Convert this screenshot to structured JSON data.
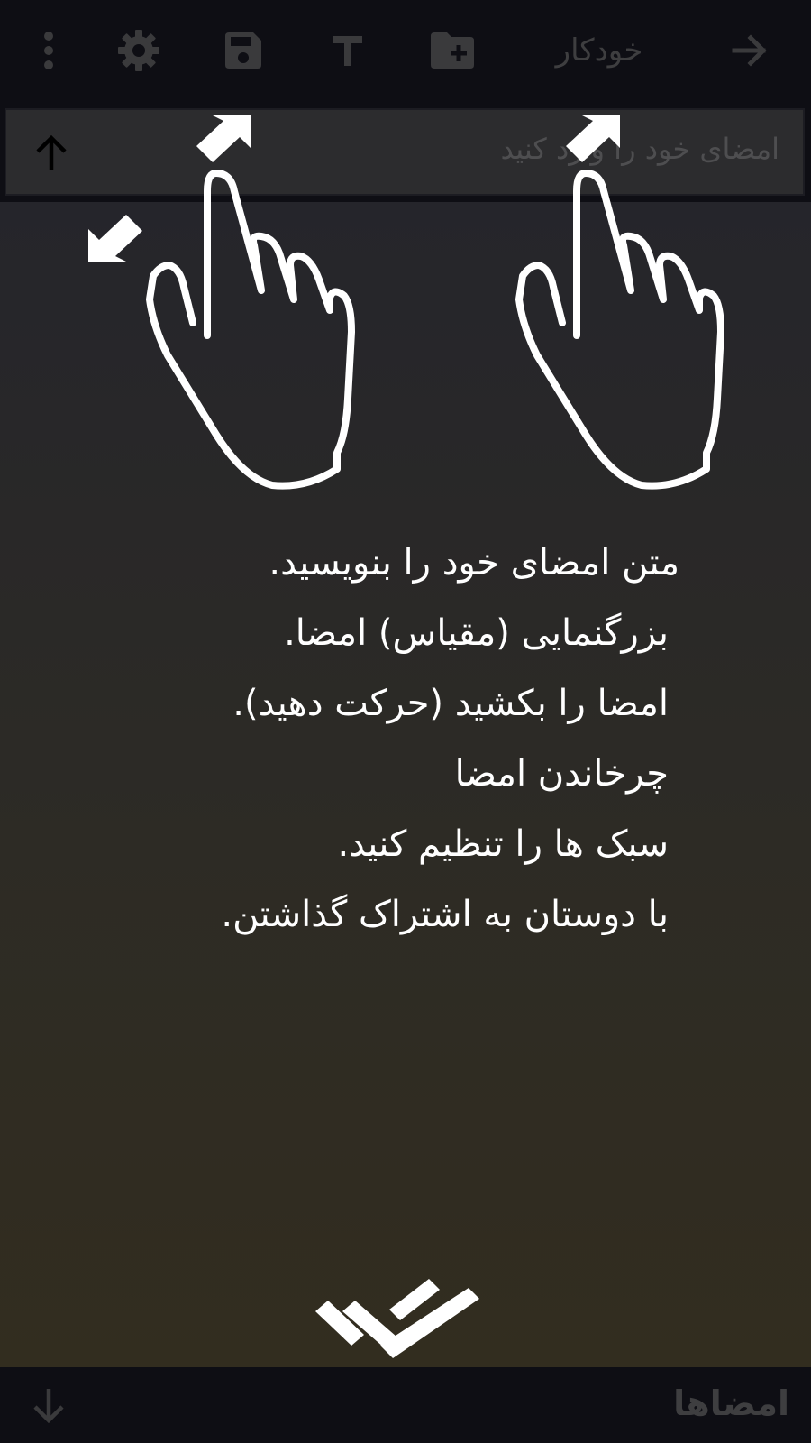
{
  "toolbar": {
    "title": "خودکار",
    "icons": [
      "forward-arrow-icon",
      "folder-add-icon",
      "text-icon",
      "save-icon",
      "gear-icon",
      "more-vert-icon"
    ]
  },
  "signature_input": {
    "placeholder": "امضای خود را وارد کنید"
  },
  "bottom_bar": {
    "tab_label": "امضاها"
  },
  "tutorial": {
    "tips": [
      "متن امضای خود را بنویسید.",
      "بزرگنمایی (مقیاس) امضا.",
      "امضا را بکشید (حرکت دهید).",
      "چرخاندن امضا",
      "سبک ها را تنظیم کنید.",
      "با دوستان به اشتراک گذاشتن."
    ],
    "gestures": [
      "pinch-scale-gesture",
      "drag-gesture"
    ],
    "done_icon": "double-check-icon"
  },
  "colors": {
    "bar_background": "#0e0e14",
    "muted_icon": "#3a3a3c",
    "input_background": "#2c2c2e",
    "overlay_text": "#ffffff"
  }
}
